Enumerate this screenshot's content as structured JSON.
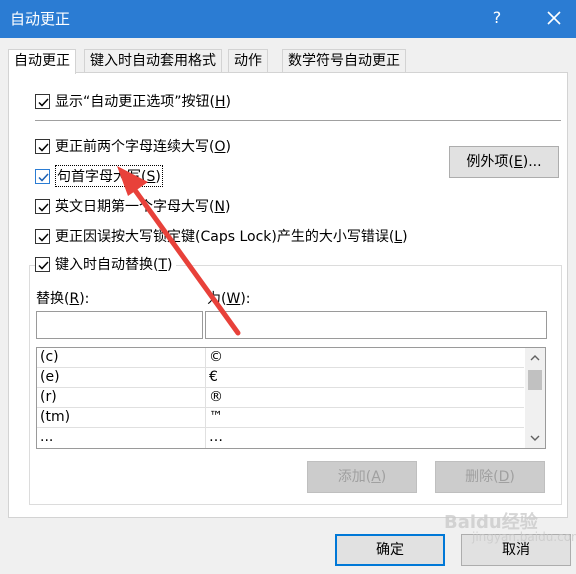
{
  "window": {
    "title": "自动更正",
    "help_label": "?",
    "close_icon": "close-icon"
  },
  "tabs": [
    {
      "label": "自动更正",
      "active": true
    },
    {
      "label": "键入时自动套用格式",
      "active": false
    },
    {
      "label": "动作",
      "active": false
    },
    {
      "label": "数学符号自动更正",
      "active": false
    }
  ],
  "options": {
    "show_buttons": {
      "text": "显示“自动更正选项”按钮(",
      "key": "H",
      "close": ")",
      "checked": true
    },
    "two_initial_caps": {
      "text": "更正前两个字母连续大写(",
      "key": "O",
      "close": ")",
      "checked": true
    },
    "capitalize_sentences": {
      "text": "句首字母大写(",
      "key": "S",
      "close": ")",
      "checked": true
    },
    "capitalize_days": {
      "text": "英文日期第一个字母大写(",
      "key": "N",
      "close": ")",
      "checked": true
    },
    "caps_lock": {
      "text": "更正因误按大写锁定键(Caps Lock)产生的大小写错误(",
      "key": "L",
      "close": ")",
      "checked": true
    },
    "replace_text": {
      "text": "键入时自动替换(",
      "key": "T",
      "close": ")",
      "checked": true
    }
  },
  "exceptions_button": {
    "text": "例外项(",
    "key": "E",
    "close": ")..."
  },
  "replace_label": {
    "text": "替换(",
    "key": "R",
    "close": "):"
  },
  "with_label": {
    "text": "为(",
    "key": "W",
    "close": "):"
  },
  "replace_input_value": "",
  "with_input_value": "",
  "entries": [
    {
      "replace": "(c)",
      "with": "©"
    },
    {
      "replace": "(e)",
      "with": "€"
    },
    {
      "replace": "(r)",
      "with": "®"
    },
    {
      "replace": "(tm)",
      "with": "™"
    },
    {
      "replace": "...",
      "with": "…"
    }
  ],
  "add_button": {
    "text": "添加(",
    "key": "A",
    "close": ")"
  },
  "delete_button": {
    "text": "删除(",
    "key": "D",
    "close": ")"
  },
  "ok_button": "确定",
  "cancel_button": "取消",
  "watermark": {
    "brand": "Baidu经验",
    "url": "jingyan.baidu.com"
  },
  "colors": {
    "titlebar": "#2b7cd3",
    "annotation_arrow": "#e8413a"
  }
}
